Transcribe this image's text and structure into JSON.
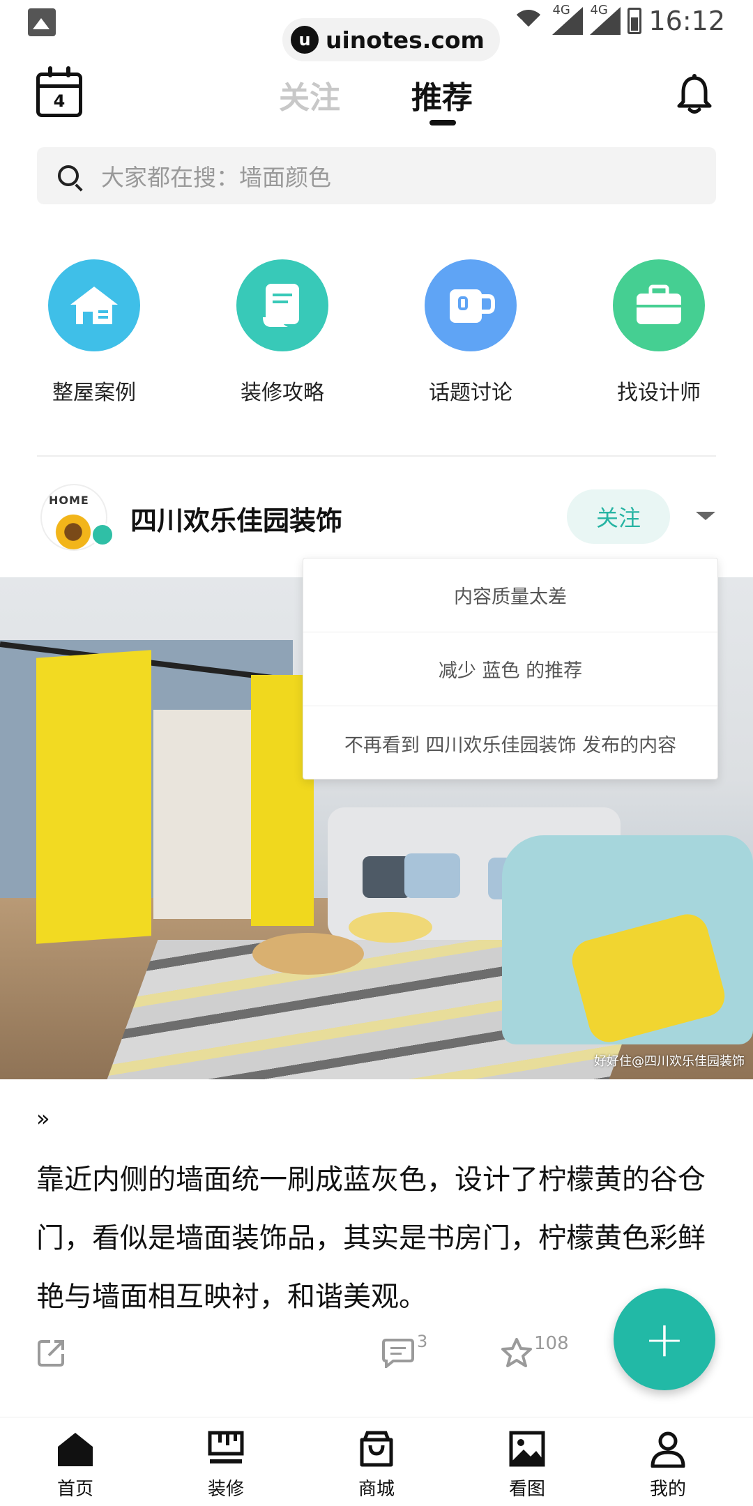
{
  "status_bar": {
    "site": "uinotes.com",
    "site_badge": "u",
    "net1": "4G",
    "net2": "4G",
    "time": "16:12"
  },
  "header": {
    "calendar_day": "4",
    "tabs": [
      {
        "label": "关注",
        "active": false
      },
      {
        "label": "推荐",
        "active": true
      }
    ]
  },
  "search": {
    "placeholder": "大家都在搜：墙面颜色"
  },
  "quick_entries": [
    {
      "label": "整屋案例",
      "color": "#3fbfe8",
      "icon": "house-icon"
    },
    {
      "label": "装修攻略",
      "color": "#38c9b8",
      "icon": "scroll-icon"
    },
    {
      "label": "话题讨论",
      "color": "#5fa4f5",
      "icon": "cup-icon"
    },
    {
      "label": "找设计师",
      "color": "#45cf92",
      "icon": "briefcase-icon"
    }
  ],
  "post": {
    "author": "四川欢乐佳园装饰",
    "avatar_text": "HOME",
    "follow_label": "关注",
    "image_caption": "好好住@四川欢乐佳园装饰",
    "quote_mark": "»",
    "text": "靠近内侧的墙面统一刷成蓝灰色，设计了柠檬黄的谷仓门，看似是墙面装饰品，其实是书房门，柠檬黄色彩鲜艳与墙面相互映衬，和谐美观。",
    "comment_count": "3",
    "favorite_count": "108"
  },
  "dropdown": {
    "items": [
      "内容质量太差",
      "减少 蓝色 的推荐",
      "不再看到 四川欢乐佳园装饰 发布的内容"
    ]
  },
  "fab": {
    "label": "+"
  },
  "bottom_nav": [
    {
      "label": "首页",
      "icon": "home-icon",
      "active": true
    },
    {
      "label": "装修",
      "icon": "brush-icon",
      "active": false
    },
    {
      "label": "商城",
      "icon": "shopping-bag-icon",
      "active": false
    },
    {
      "label": "看图",
      "icon": "image-icon",
      "active": false
    },
    {
      "label": "我的",
      "icon": "user-icon",
      "active": false
    }
  ],
  "colors": {
    "accent": "#22b9a6",
    "follow_bg": "#e9f6f4",
    "follow_text": "#27b4a3"
  }
}
